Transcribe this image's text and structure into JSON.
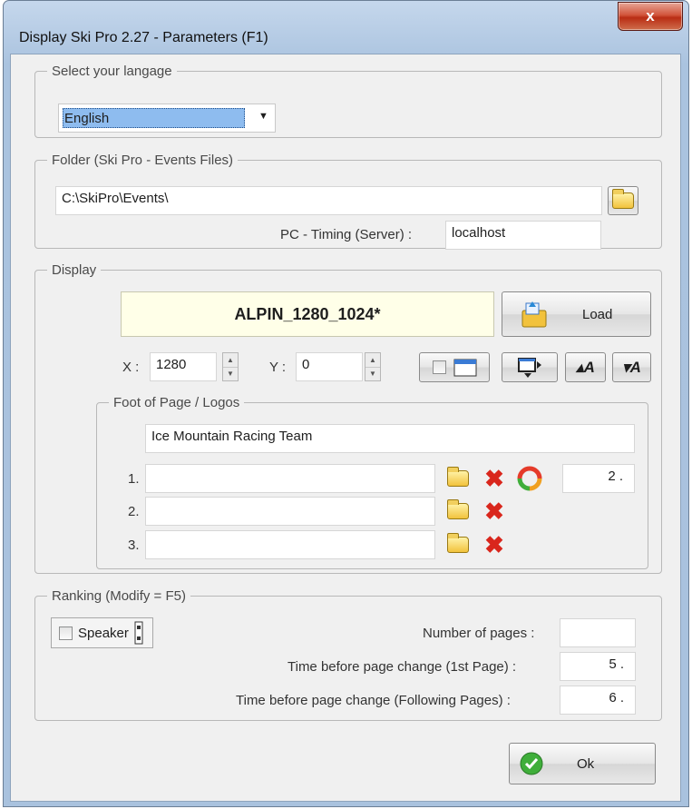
{
  "window": {
    "title": "Display Ski Pro 2.27 - Parameters (F1)",
    "close_label": "x"
  },
  "language": {
    "legend": "Select your langage",
    "selected": "English",
    "arrow": "▼"
  },
  "folder": {
    "legend": "Folder (Ski Pro - Events Files)",
    "path": "C:\\SkiPro\\Events\\",
    "server_label": "PC - Timing (Server) :",
    "server_value": "localhost"
  },
  "display": {
    "legend": "Display",
    "layout_name": "ALPIN_1280_1024*",
    "load_label": "Load",
    "x_label": "X :",
    "x_value": "1280",
    "y_label": "Y :",
    "y_value": "0"
  },
  "foot": {
    "legend": "Foot of Page / Logos",
    "text": "Ice Mountain Racing Team",
    "logos": [
      {
        "label": "1.",
        "path": ""
      },
      {
        "label": "2.",
        "path": ""
      },
      {
        "label": "3.",
        "path": ""
      }
    ],
    "rotation_value": "2 ."
  },
  "ranking": {
    "legend": "Ranking (Modify = F5)",
    "speaker_label": "Speaker",
    "pages_label": "Number of pages :",
    "pages_value": "",
    "time_first_label": "Time before page change (1st Page) :",
    "time_first_value": "5 .",
    "time_following_label": "Time before page change (Following Pages) :",
    "time_following_value": "6 ."
  },
  "ok_label": "Ok",
  "colors": {
    "accent_select": "#3399ff",
    "layout_box": "#ffffe8",
    "ok_green": "#3fae3a",
    "delete_red": "#d9261c"
  }
}
